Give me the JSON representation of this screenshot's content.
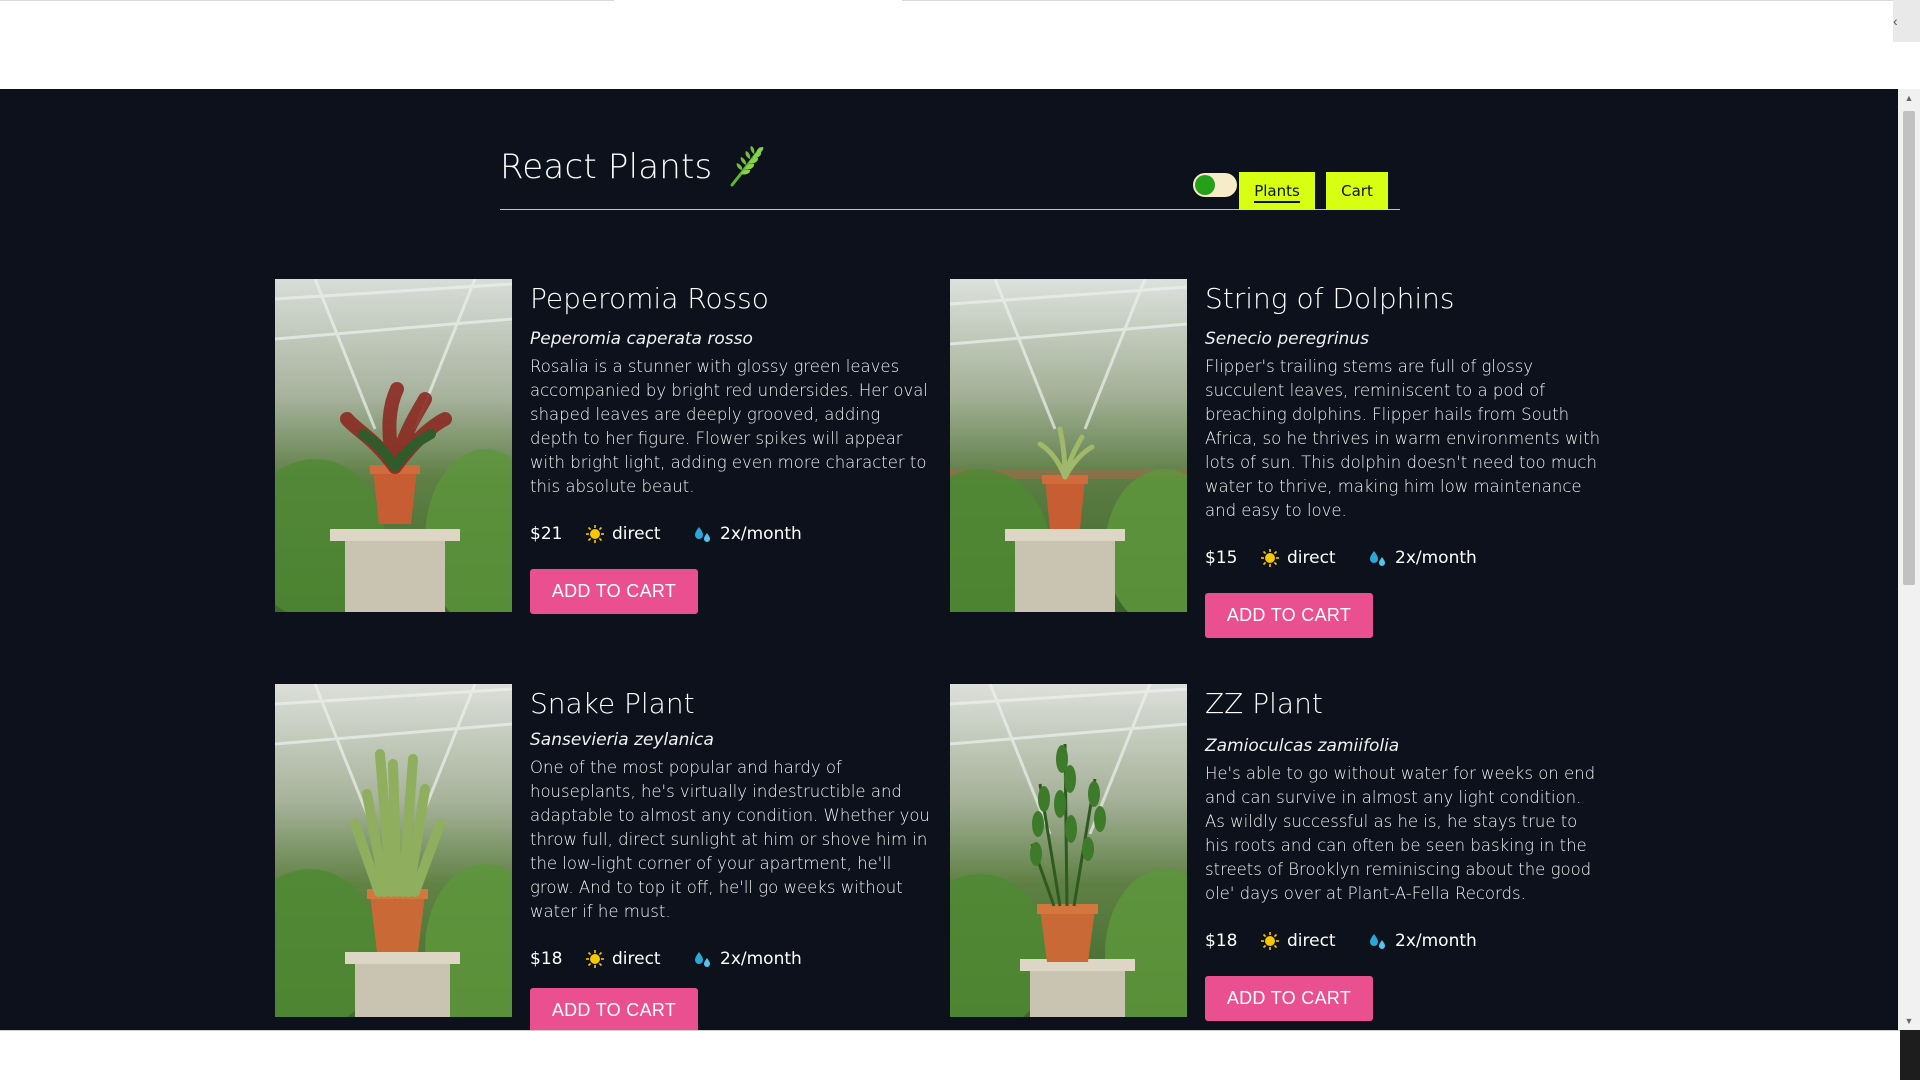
{
  "header": {
    "title": "React Plants",
    "nav": {
      "plants_label": "Plants",
      "cart_label": "Cart"
    }
  },
  "colors": {
    "background": "#0d111c",
    "accent_nav": "#d7ff12",
    "button": "#ea4f8f",
    "divider": "#c0e030"
  },
  "plants": [
    {
      "name": "Peperomia Rosso",
      "scientific_name": "Peperomia caperata rosso",
      "description": "Rosalia is a stunner with glossy green leaves accompanied by bright red undersides. Her oval shaped leaves are deeply grooved, adding depth to her figure. Flower spikes will appear with bright light, adding even more character to this absolute beaut.",
      "price": "$21",
      "light": "direct",
      "water": "2x/month",
      "button_label": "ADD TO CART"
    },
    {
      "name": "String of Dolphins",
      "scientific_name": "Senecio peregrinus",
      "description": "Flipper's trailing stems are full of glossy succulent leaves, reminiscent to a pod of breaching dolphins. Flipper hails from South Africa, so he thrives in warm environments with lots of sun. This dolphin doesn't need too much water to thrive, making him low maintenance and easy to love.",
      "price": "$15",
      "light": "direct",
      "water": "2x/month",
      "button_label": "ADD TO CART"
    },
    {
      "name": "Snake Plant",
      "scientific_name": "Sansevieria zeylanica",
      "description": "One of the most popular and hardy of houseplants, he's virtually indestructible and adaptable to almost any condition. Whether you throw full, direct sunlight at him or shove him in the low-light corner of your apartment, he'll grow. And to top it off, he'll go weeks without water if he must.",
      "price": "$18",
      "light": "direct",
      "water": "2x/month",
      "button_label": "ADD TO CART"
    },
    {
      "name": "ZZ Plant",
      "scientific_name": "Zamioculcas zamiifolia",
      "description": "He's able to go without water for weeks on end and can survive in almost any light condition. As wildly successful as he is, he stays true to his roots and can often be seen basking in the streets of Brooklyn reminiscing about the good ole' days over at Plant-A-Fella Records.",
      "price": "$18",
      "light": "direct",
      "water": "2x/month",
      "button_label": "ADD TO CART"
    }
  ]
}
